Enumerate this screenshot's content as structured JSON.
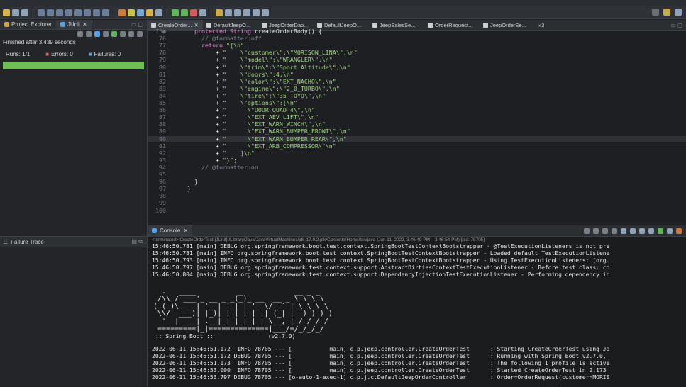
{
  "left_panel": {
    "tabs": [
      {
        "label": "Project Explorer"
      },
      {
        "label": "JUnit"
      }
    ],
    "finished": "Finished after 3.439 seconds",
    "runs_label": "Runs:",
    "runs_value": "1/1",
    "errors_label": "Errors:",
    "errors_value": "0",
    "failures_label": "Failures:",
    "failures_value": "0",
    "progress_fraction": 1.0,
    "progress_color": "#6fbf56",
    "failure_trace_label": "Failure Trace"
  },
  "editor": {
    "tabs": [
      {
        "label": "CreateOrder..."
      },
      {
        "label": "DefaultJeepO..."
      },
      {
        "label": "JeepOrderDao..."
      },
      {
        "label": "DefaultJeepO..."
      },
      {
        "label": "JeepSalesSe..."
      },
      {
        "label": "OrderRequest..."
      },
      {
        "label": "JeepOrderSe..."
      },
      {
        "label": "»3"
      }
    ],
    "lines": [
      {
        "num": "75●",
        "text": "  protected String createOrderBody() {"
      },
      {
        "num": "76",
        "text": "    // @formatter:off"
      },
      {
        "num": "77",
        "text": "    return \"{\\n\""
      },
      {
        "num": "78",
        "text": "        + \"    \\\"customer\\\":\\\"MORISON_LINA\\\",\\n\""
      },
      {
        "num": "79",
        "text": "        + \"    \\\"model\\\":\\\"WRANGLER\\\",\\n\""
      },
      {
        "num": "80",
        "text": "        + \"    \\\"trim\\\":\\\"Sport Altitude\\\",\\n\""
      },
      {
        "num": "81",
        "text": "        + \"    \\\"doors\\\":4,\\n\""
      },
      {
        "num": "82",
        "text": "        + \"    \\\"color\\\":\\\"EXT_NACHO\\\",\\n\""
      },
      {
        "num": "83",
        "text": "        + \"    \\\"engine\\\":\\\"2_0_TURBO\\\",\\n\""
      },
      {
        "num": "84",
        "text": "        + \"    \\\"tire\\\":\\\"35_TOYO\\\",\\n\""
      },
      {
        "num": "85",
        "text": "        + \"    \\\"options\\\":[\\n\""
      },
      {
        "num": "86",
        "text": "        + \"      \\\"DOOR_QUAD_4\\\",\\n\""
      },
      {
        "num": "87",
        "text": "        + \"      \\\"EXT_AEV_LIFT\\\",\\n\""
      },
      {
        "num": "88",
        "text": "        + \"      \\\"EXT_WARN_WINCH\\\",\\n\""
      },
      {
        "num": "89",
        "text": "        + \"      \\\"EXT_WARN_BUMPER_FRONT\\\",\\n\""
      },
      {
        "num": "90",
        "text": "        + \"      \\\"EXT_WARN_BUMPER_REAR\\\",\\n\""
      },
      {
        "num": "91",
        "text": "        + \"      \\\"EXT_ARB_COMPRESSOR\\\"\\n\""
      },
      {
        "num": "92",
        "text": "        + \"    ]\\n\""
      },
      {
        "num": "93",
        "text": "        + \"}\";"
      },
      {
        "num": "94",
        "text": "    // @formatter:on"
      },
      {
        "num": "95",
        "text": ""
      },
      {
        "num": "96",
        "text": "  }"
      },
      {
        "num": "97",
        "text": "}"
      },
      {
        "num": "98",
        "text": ""
      },
      {
        "num": "99",
        "text": ""
      },
      {
        "num": "100",
        "text": ""
      }
    ]
  },
  "console": {
    "tab_label": "Console",
    "terminated": "<terminated> CreateOrderTest [JUnit] /Library/Java/JavaVirtualMachines/jdk-17.0.2.jdk/Contents/Home/bin/java  (Jun 11, 2022, 3:46:49 PM – 3:46:54 PM) [pid: 78705]",
    "log_lines": [
      "15:46:50.781 [main] DEBUG org.springframework.boot.test.context.SpringBootTestContextBootstrapper - @TestExecutionListeners is not pre",
      "15:46:50.781 [main] INFO org.springframework.boot.test.context.SpringBootTestContextBootstrapper - Loaded default TestExecutionListene",
      "15:46:50.793 [main] INFO org.springframework.boot.test.context.SpringBootTestContextBootstrapper - Using TestExecutionListeners: [org.",
      "15:46:50.797 [main] DEBUG org.springframework.test.context.support.AbstractDirtiesContextTestExecutionListener - Before test class: co",
      "15:46:50.804 [main] DEBUG org.springframework.test.context.support.DependencyInjectionTestExecutionListener - Performing dependency in"
    ],
    "banner_lines": [
      "  .   ____          _            __ _ _",
      " /\\\\ / ___'_ __ _ _(_)_ __  __ _ \\ \\ \\ \\",
      "( ( )\\___ | '_ | '_| | '_ \\/ _` | \\ \\ \\ \\",
      " \\\\/  ___)| |_)| | | | | || (_| |  ) ) ) )",
      "  '  |____| .__|_| |_|_| |_\\__, | / / / /",
      " =========|_|==============|___/=/_/_/_/"
    ],
    "spring_boot_line": " :: Spring Boot ::                (v2.7.0)",
    "app_lines": [
      "2022-06-11 15:46:51.172  INFO 78705 --- [           main] c.p.jeep.controller.CreateOrderTest      : Starting CreateOrderTest using Ja",
      "2022-06-11 15:46:51.172 DEBUG 78705 --- [           main] c.p.jeep.controller.CreateOrderTest      : Running with Spring Boot v2.7.0,",
      "2022-06-11 15:46:51.173  INFO 78705 --- [           main] c.p.jeep.controller.CreateOrderTest      : The following 1 profile is active",
      "2022-06-11 15:46:53.000  INFO 78705 --- [           main] c.p.jeep.controller.CreateOrderTest      : Started CreateOrderTest in 2.173",
      "2022-06-11 15:46:53.797 DEBUG 78705 --- [o-auto-1-exec-1] c.p.j.c.DefaultJeepOrderController       : Order=OrderRequest(customer=MORIS"
    ]
  }
}
